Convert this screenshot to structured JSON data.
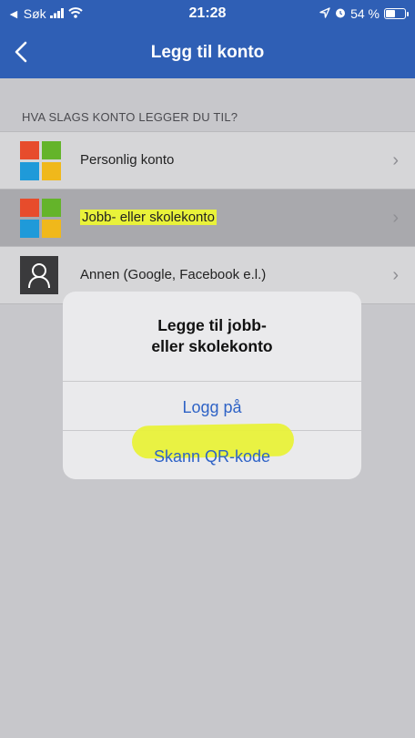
{
  "status_bar": {
    "back_app": "◄ Søk",
    "time": "21:28",
    "battery_percent": "54 %",
    "battery_level": 0.54,
    "icons": [
      "signal-icon",
      "wifi-icon",
      "location-icon",
      "alarm-icon",
      "battery-icon"
    ]
  },
  "nav": {
    "title": "Legg til konto",
    "back_icon": "chevron-left-icon"
  },
  "section_header": "HVA SLAGS KONTO LEGGER DU TIL?",
  "accounts": [
    {
      "label": "Personlig konto",
      "icon": "microsoft-logo-icon",
      "selected": false,
      "highlighted": false
    },
    {
      "label": "Jobb- eller skolekonto",
      "icon": "microsoft-logo-icon",
      "selected": true,
      "highlighted": true
    },
    {
      "label": "Annen (Google, Facebook e.l.)",
      "icon": "person-icon",
      "selected": false,
      "highlighted": false
    }
  ],
  "dialog": {
    "title_line1": "Legge til jobb-",
    "title_line2": "eller skolekonto",
    "sign_in": "Logg på",
    "scan_qr": "Skann QR-kode"
  },
  "colors": {
    "header_blue": "#2f5fb5",
    "link_blue": "#2f63c6",
    "highlight_yellow": "#e9f23a",
    "ms_red": "#e74c2c",
    "ms_green": "#64b42a",
    "ms_blue": "#1f9ad9",
    "ms_yellow": "#f0b81b"
  }
}
